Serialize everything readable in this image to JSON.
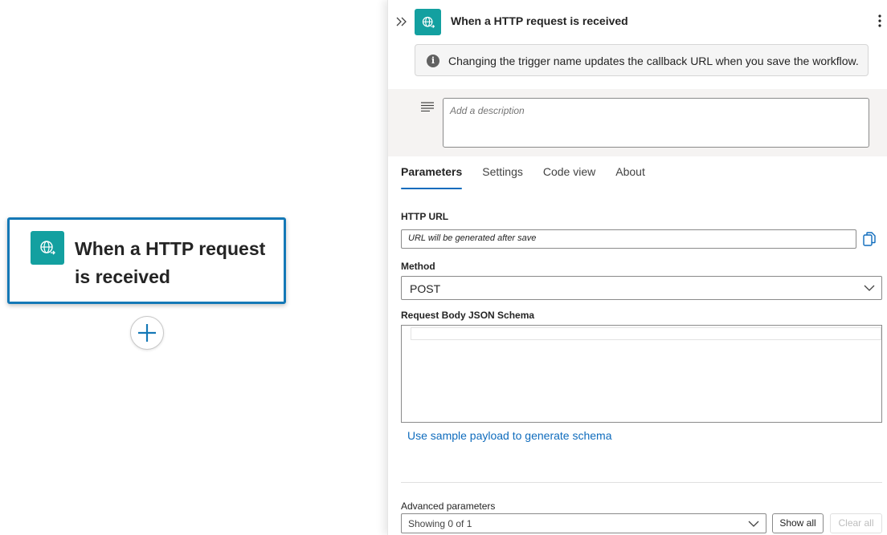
{
  "canvas": {
    "node": {
      "title": "When a HTTP request is received",
      "icon": "http-request-globe-icon"
    },
    "add_button_icon": "plus-icon"
  },
  "panel": {
    "header": {
      "title": "When a HTTP request is received",
      "icon": "http-request-globe-icon"
    },
    "info_message": "Changing the trigger name updates the callback URL when you save the workflow.",
    "description": {
      "placeholder": "Add a description",
      "value": ""
    },
    "tabs": [
      {
        "label": "Parameters",
        "active": true
      },
      {
        "label": "Settings",
        "active": false
      },
      {
        "label": "Code view",
        "active": false
      },
      {
        "label": "About",
        "active": false
      }
    ],
    "http_url": {
      "label": "HTTP URL",
      "value": "URL will be generated after save"
    },
    "method": {
      "label": "Method",
      "value": "POST"
    },
    "schema": {
      "label": "Request Body JSON Schema",
      "value": ""
    },
    "sample_payload_link": "Use sample payload to generate schema",
    "advanced": {
      "label": "Advanced parameters",
      "value": "Showing 0 of 1",
      "show_all": "Show all",
      "clear_all": "Clear all"
    }
  },
  "colors": {
    "accent": "#0f6cbd",
    "node_border": "#1478b6",
    "icon_bg": "#13a0a0"
  }
}
